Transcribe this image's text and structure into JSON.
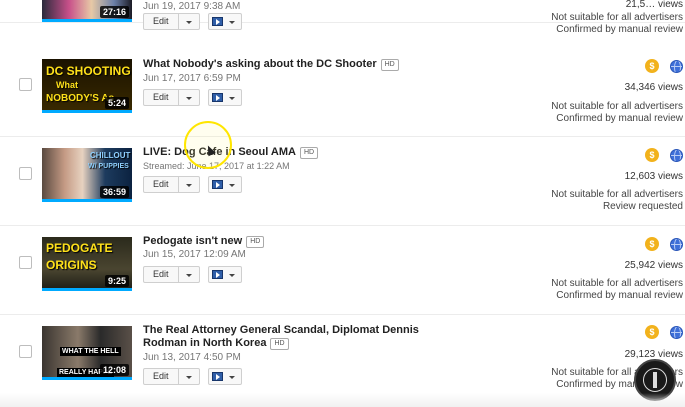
{
  "videos": [
    {
      "title": "",
      "hd": "",
      "date": "Jun 19, 2017 9:38 AM",
      "duration": "27:16",
      "views": "21,5… views",
      "status_line1": "Not suitable for all advertisers",
      "status_line2": "Confirmed by manual review",
      "edit_label": "Edit"
    },
    {
      "title": "What Nobody's asking about the DC Shooter",
      "hd": "HD",
      "date": "Jun 17, 2017 6:59 PM",
      "duration": "5:24",
      "thumb_text1": "DC SHOOTING",
      "thumb_text2": "What",
      "thumb_text3": "NOBODY'S As",
      "views": "34,346 views",
      "status_line1": "Not suitable for all advertisers",
      "status_line2": "Confirmed by manual review",
      "edit_label": "Edit"
    },
    {
      "title": "LIVE: Dog Cafe in Seoul AMA",
      "hd": "HD",
      "date": "Streamed: June 17, 2017 at 1:22 AM",
      "duration": "36:59",
      "thumb_text1": "CHILLOUT",
      "thumb_text2": "W/ PUPPIES",
      "views": "12,603 views",
      "status_line1": "Not suitable for all advertisers",
      "status_line2": "Review requested",
      "edit_label": "Edit"
    },
    {
      "title": "Pedogate isn't new",
      "hd": "HD",
      "date": "Jun 15, 2017 12:09 AM",
      "duration": "9:25",
      "thumb_text1": "PEDOGATE",
      "thumb_text2": "ORIGINS",
      "views": "25,942 views",
      "status_line1": "Not suitable for all advertisers",
      "status_line2": "Confirmed by manual review",
      "edit_label": "Edit"
    },
    {
      "title": "The Real Attorney General Scandal, Diplomat Dennis",
      "title2": "Rodman in North Korea",
      "hd": "HD",
      "date": "Jun 13, 2017 4:50 PM",
      "duration": "12:08",
      "thumb_text1": "WHAT THE HELL",
      "thumb_text2": "REALLY HAPPE",
      "views": "29,123 views",
      "status_line1": "Not suitable for all advertisers",
      "status_line2": "Confirmed by manual review",
      "edit_label": "Edit"
    }
  ],
  "icons": {
    "monetization": "dollar-coin-icon",
    "visibility": "globe-icon",
    "promote": "promote-icon",
    "dropdown": "chevron-down-icon"
  },
  "colors": {
    "coin": "#f2b21c",
    "globe": "#3e6fd8",
    "progress": "#00aaff",
    "cursor_highlight": "#ffe600"
  }
}
